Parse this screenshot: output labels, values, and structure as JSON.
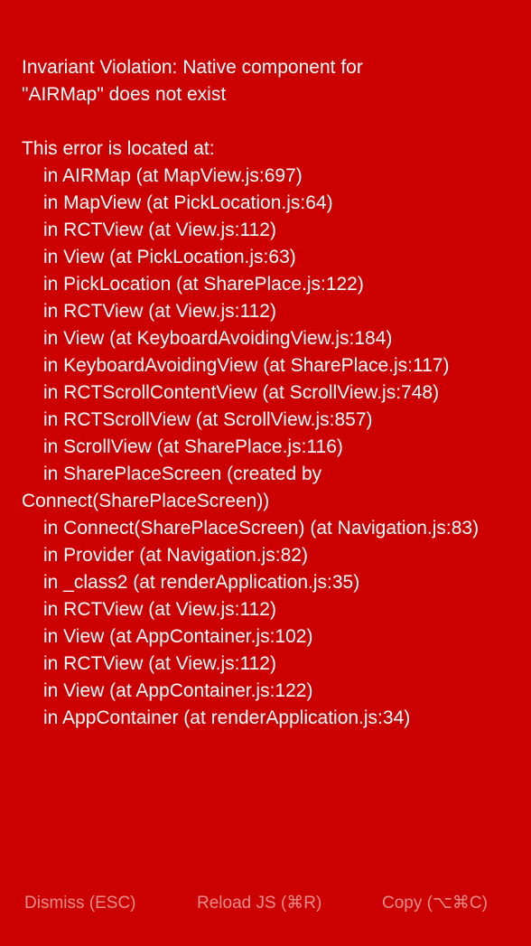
{
  "error": {
    "title": "Invariant Violation: Native component for\n\"AIRMap\" does not exist",
    "stack_header": "This error is located at:",
    "stack": [
      "in AIRMap (at MapView.js:697)",
      "in MapView (at PickLocation.js:64)",
      "in RCTView (at View.js:112)",
      "in View (at PickLocation.js:63)",
      "in PickLocation (at SharePlace.js:122)",
      "in RCTView (at View.js:112)",
      "in View (at KeyboardAvoidingView.js:184)",
      "in KeyboardAvoidingView (at SharePlace.js:117)",
      "in RCTScrollContentView (at ScrollView.js:748)",
      "in RCTScrollView (at ScrollView.js:857)",
      "in ScrollView (at SharePlace.js:116)",
      "in SharePlaceScreen (created by Connect(SharePlaceScreen))",
      "in Connect(SharePlaceScreen) (at Navigation.js:83)",
      "in Provider (at Navigation.js:82)",
      "in _class2 (at renderApplication.js:35)",
      "in RCTView (at View.js:112)",
      "in View (at AppContainer.js:102)",
      "in RCTView (at View.js:112)",
      "in View (at AppContainer.js:122)",
      "in AppContainer (at renderApplication.js:34)"
    ]
  },
  "buttons": {
    "dismiss": "Dismiss (ESC)",
    "reload": "Reload JS (⌘R)",
    "copy": "Copy (⌥⌘C)"
  },
  "colors": {
    "background": "#cc0000",
    "text": "#ffffff",
    "button_text": "#ee8888"
  }
}
